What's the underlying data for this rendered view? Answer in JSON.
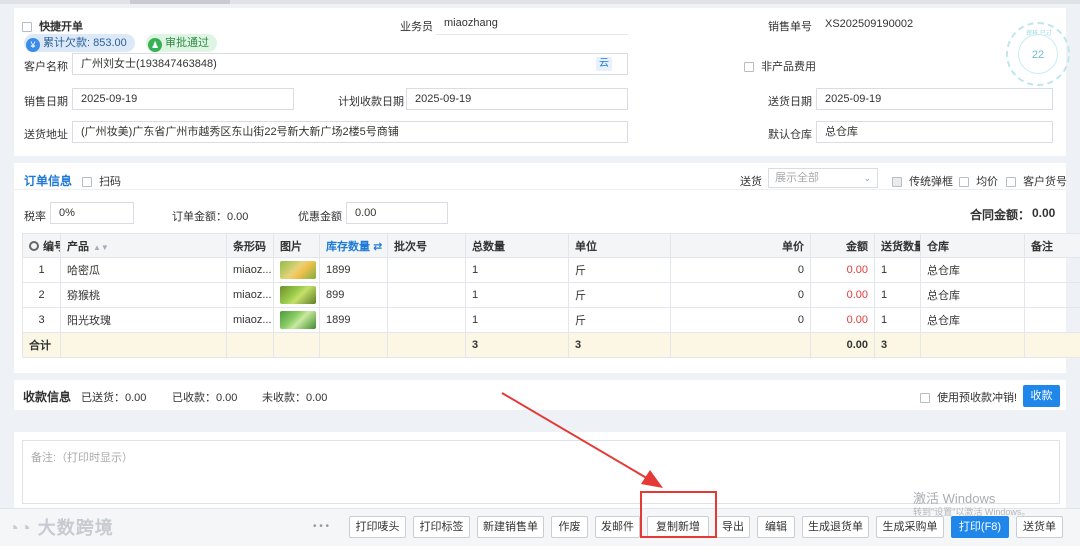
{
  "header": {
    "quick_order_label": "快捷开单",
    "debt_label": "累计欠款: 853.00",
    "approval_label": "审批通过",
    "salesman_label": "业务员",
    "salesman_value": "miaozhang",
    "sale_no_label": "销售单号",
    "sale_no_value": "XS202509190002",
    "customer_label": "客户名称",
    "customer_value": "广州刘女士(193847463848)",
    "cloud_label": "云",
    "non_product_label": "非产品费用",
    "sale_date_label": "销售日期",
    "sale_date_value": "2025-09-19",
    "plan_date_label": "计划收款日期",
    "plan_date_value": "2025-09-19",
    "delivery_date_label": "送货日期",
    "delivery_date_value": "2025-09-19",
    "address_label": "送货地址",
    "address_value": "(广州妆美)广东省广州市越秀区东山街22号新大新广场2楼5号商铺",
    "warehouse_label": "默认仓库",
    "warehouse_value": "总仓库",
    "seal_number": "22"
  },
  "order": {
    "title": "订单信息",
    "scan_label": "扫码",
    "delivery_label": "送货",
    "delivery_placeholder": "展示全部",
    "popup_label": "传统弹框",
    "avg_price_label": "均价",
    "customer_code_label": "客户货号",
    "tax_label": "税率",
    "tax_value": "0%",
    "order_amount_label": "订单金额：0.00",
    "discount_label": "优惠金额",
    "discount_value": "0.00",
    "contract_label": "合同金额：",
    "contract_value": "0.00",
    "columns": [
      "编号",
      "产品",
      "条形码",
      "图片",
      "库存数量",
      "批次号",
      "总数量",
      "单位",
      "单价",
      "金额",
      "送货数量",
      "仓库",
      "备注"
    ],
    "rows": [
      {
        "no": "1",
        "product": "哈密瓜",
        "barcode": "miaoz...",
        "thumb": "melon",
        "stock": "1899",
        "batch": "",
        "qty": "1",
        "unit": "斤",
        "price": "0",
        "amount": "0.00",
        "deliver_qty": "1",
        "warehouse": "总仓库",
        "note": ""
      },
      {
        "no": "2",
        "product": "猕猴桃",
        "barcode": "miaoz...",
        "thumb": "kiwi",
        "stock": "899",
        "batch": "",
        "qty": "1",
        "unit": "斤",
        "price": "0",
        "amount": "0.00",
        "deliver_qty": "1",
        "warehouse": "总仓库",
        "note": ""
      },
      {
        "no": "3",
        "product": "阳光玫瑰",
        "barcode": "miaoz...",
        "thumb": "grape",
        "stock": "1899",
        "batch": "",
        "qty": "1",
        "unit": "斤",
        "price": "0",
        "amount": "0.00",
        "deliver_qty": "1",
        "warehouse": "总仓库",
        "note": ""
      }
    ],
    "sum_label": "合计",
    "sum_qty": "3",
    "sum_unit": "3",
    "sum_amount": "0.00",
    "sum_deliver": "3"
  },
  "payment": {
    "title": "收款信息",
    "delivered": "已送货：0.00",
    "received": "已收款：0.00",
    "unreceived": "未收款：0.00",
    "prepay_label": "使用预收款冲销!",
    "receive_button": "收款"
  },
  "memo": {
    "placeholder": "备注:（打印时显示）"
  },
  "toolbar": {
    "more": "• • •",
    "print_head": "打印唛头",
    "print_label": "打印标签",
    "new_sale": "新建销售单",
    "void": "作废",
    "send_mail": "发邮件",
    "copy_new": "复制新增",
    "export": "导出",
    "edit": "编辑",
    "gen_return": "生成退货单",
    "gen_purchase": "生成采购单",
    "print_f8": "打印(F8)",
    "delivery_note": "送货单"
  },
  "overlay": {
    "logo_text": "大数跨境",
    "windows_line1": "激活 Windows",
    "windows_line2": "转到\"设置\"以激活 Windows。"
  },
  "colors": {
    "accent": "#1f86ea",
    "highlight_box": "#e53935",
    "amount_red": "#e03b3b"
  }
}
